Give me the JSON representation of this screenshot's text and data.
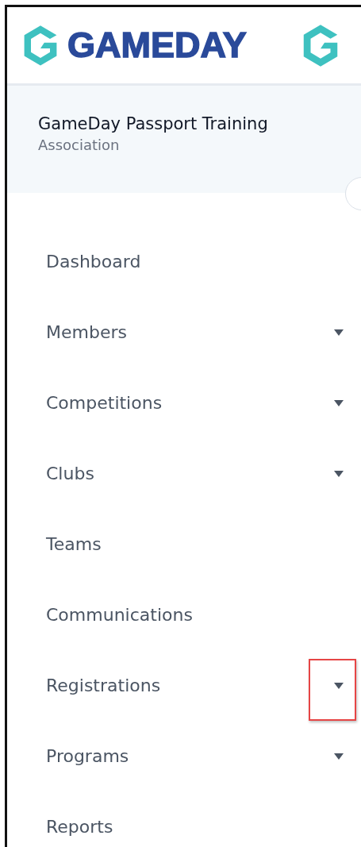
{
  "logo": {
    "wordmark": "GAMEDAY"
  },
  "organisation": {
    "name": "GameDay Passport Training",
    "type": "Association"
  },
  "nav": [
    {
      "label": "Dashboard",
      "expandable": false,
      "highlighted": false
    },
    {
      "label": "Members",
      "expandable": true,
      "highlighted": false
    },
    {
      "label": "Competitions",
      "expandable": true,
      "highlighted": false
    },
    {
      "label": "Clubs",
      "expandable": true,
      "highlighted": false
    },
    {
      "label": "Teams",
      "expandable": false,
      "highlighted": false
    },
    {
      "label": "Communications",
      "expandable": false,
      "highlighted": false
    },
    {
      "label": "Registrations",
      "expandable": true,
      "highlighted": true
    },
    {
      "label": "Programs",
      "expandable": true,
      "highlighted": false
    },
    {
      "label": "Reports",
      "expandable": false,
      "highlighted": false
    }
  ]
}
